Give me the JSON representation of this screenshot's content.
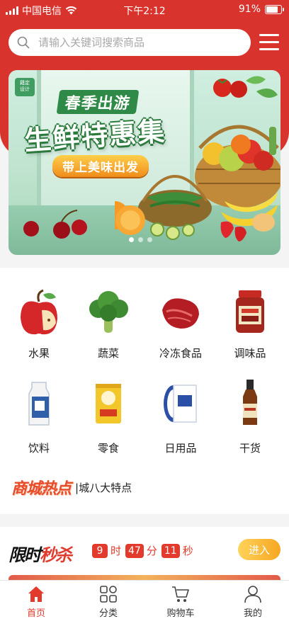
{
  "status_bar": {
    "carrier": "中国电信",
    "time": "下午2:12",
    "battery": "91%",
    "battery_level": 0.91
  },
  "search": {
    "placeholder": "请输入关键词搜索商品"
  },
  "banner": {
    "tag_line1": "籍定",
    "tag_line2": "设计",
    "title_small": "春季出游",
    "title_big": "生鲜特惠集",
    "pill": "带上美味出发",
    "dots": 3,
    "active_dot": 0
  },
  "categories": [
    {
      "label": "水果",
      "icon": "apple-icon"
    },
    {
      "label": "蔬菜",
      "icon": "broccoli-icon"
    },
    {
      "label": "冷冻食品",
      "icon": "meat-icon"
    },
    {
      "label": "调味品",
      "icon": "sauce-jar-icon"
    },
    {
      "label": "饮料",
      "icon": "milk-carton-icon"
    },
    {
      "label": "零食",
      "icon": "snack-bag-icon"
    },
    {
      "label": "日用品",
      "icon": "tissue-pack-icon"
    },
    {
      "label": "干货",
      "icon": "bottle-icon"
    }
  ],
  "hot": {
    "logo": "商城热点",
    "text": "|城八大特点"
  },
  "flash_sale": {
    "logo_a": "限时",
    "logo_b": "秒杀",
    "hours": "9",
    "hours_unit": "时",
    "minutes": "47",
    "minutes_unit": "分",
    "seconds": "11",
    "seconds_unit": "秒",
    "enter_label": "进入"
  },
  "tabs": [
    {
      "label": "首页",
      "icon": "home-icon",
      "active": true
    },
    {
      "label": "分类",
      "icon": "grid-icon",
      "active": false
    },
    {
      "label": "购物车",
      "icon": "cart-icon",
      "active": false
    },
    {
      "label": "我的",
      "icon": "user-icon",
      "active": false
    }
  ],
  "colors": {
    "primary_red": "#d9332e",
    "accent_orange": "#f6a623"
  }
}
